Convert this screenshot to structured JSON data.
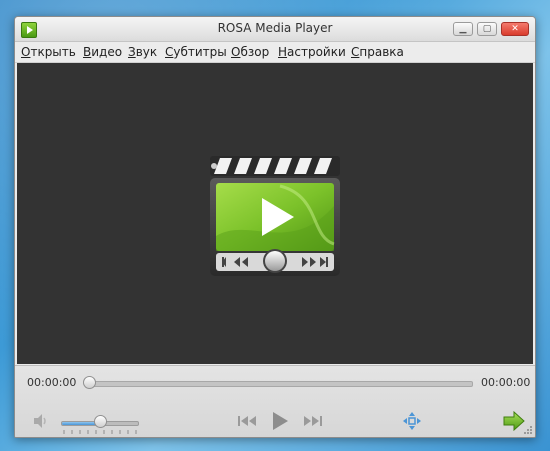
{
  "window": {
    "title": "ROSA Media Player"
  },
  "menu": {
    "items": [
      {
        "label": "Открыть"
      },
      {
        "label": "Видео"
      },
      {
        "label": "Звук"
      },
      {
        "label": "Субтитры"
      },
      {
        "label": "Обзор"
      },
      {
        "label": "Настройки"
      },
      {
        "label": "Справка"
      }
    ]
  },
  "playback": {
    "current_time": "00:00:00",
    "total_time": "00:00:00",
    "seek_position": 0.0,
    "volume_level": 0.5
  },
  "icons": {
    "app": "app-logo-icon",
    "minimize": "minimize-icon",
    "maximize": "maximize-icon",
    "close": "close-icon",
    "clapperboard": "clapperboard-logo-icon",
    "mute": "speaker-icon",
    "rewind": "rewind-icon",
    "play": "play-icon",
    "forward": "fast-forward-icon",
    "fullscreen": "fullscreen-icon",
    "next": "next-arrow-icon"
  },
  "colors": {
    "video_background": "#333333",
    "accent_green": "#7cc22a",
    "accent_blue": "#4b95d6"
  }
}
